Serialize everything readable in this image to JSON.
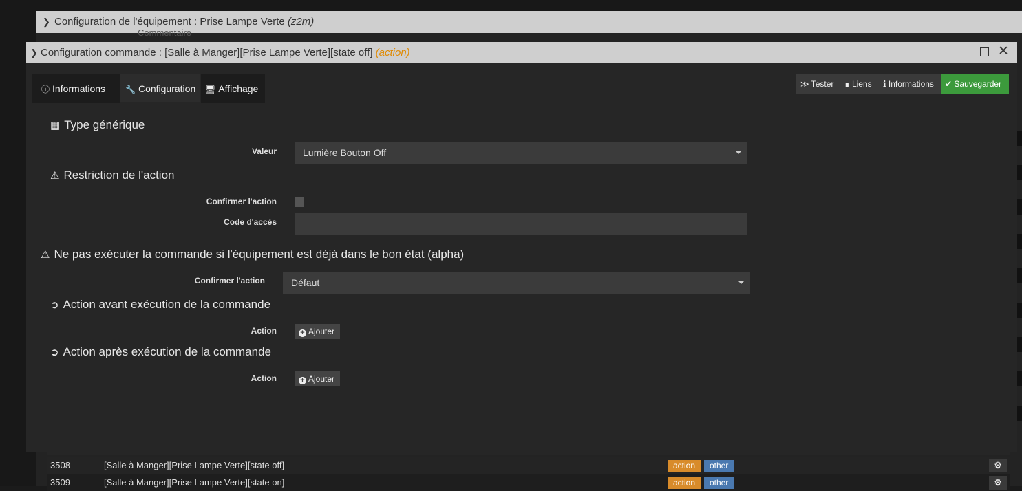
{
  "outer": {
    "title": "Configuration de l'équipement : Prise Lampe Verte ",
    "title_tag": "(z2m)",
    "ghost_label": "Commentaire"
  },
  "dialog": {
    "title": "Configuration commande : [Salle à Manger][Prise Lampe Verte][state off] ",
    "title_tag": "(action)"
  },
  "tabs": [
    {
      "label": "Informations",
      "icon": "info-circle-icon"
    },
    {
      "label": "Configuration",
      "icon": "wrench-icon"
    },
    {
      "label": "Affichage",
      "icon": "desktop-icon"
    }
  ],
  "toolbar": {
    "tester": "Tester",
    "liens": "Liens",
    "informations": "Informations",
    "save": "Sauvegarder"
  },
  "sections": {
    "generic": "Type générique",
    "restriction": "Restriction de l'action",
    "already_state": "Ne pas exécuter la commande si l'équipement est déjà dans le bon état (alpha)",
    "before": "Action avant exécution de la commande",
    "after": "Action après exécution de la commande"
  },
  "fields": {
    "valeur_label": "Valeur",
    "valeur_value": "Lumière Bouton Off",
    "confirm_label": "Confirmer l'action",
    "code_label": "Code d'accès",
    "confirm2_label": "Confirmer l'action",
    "confirm2_value": "Défaut",
    "action_label": "Action",
    "add_label": "Ajouter"
  },
  "table": {
    "rows": [
      {
        "id": "3508",
        "name": "[Salle à Manger][Prise Lampe Verte][state off]",
        "type": "action",
        "subtype": "other"
      },
      {
        "id": "3509",
        "name": "[Salle à Manger][Prise Lampe Verte][state on]",
        "type": "action",
        "subtype": "other"
      }
    ]
  },
  "colors": {
    "accent_green": "#3c9a3c",
    "tag_orange": "#e08a00",
    "badge_action": "#d88b2a",
    "badge_other": "#4a79b0"
  }
}
